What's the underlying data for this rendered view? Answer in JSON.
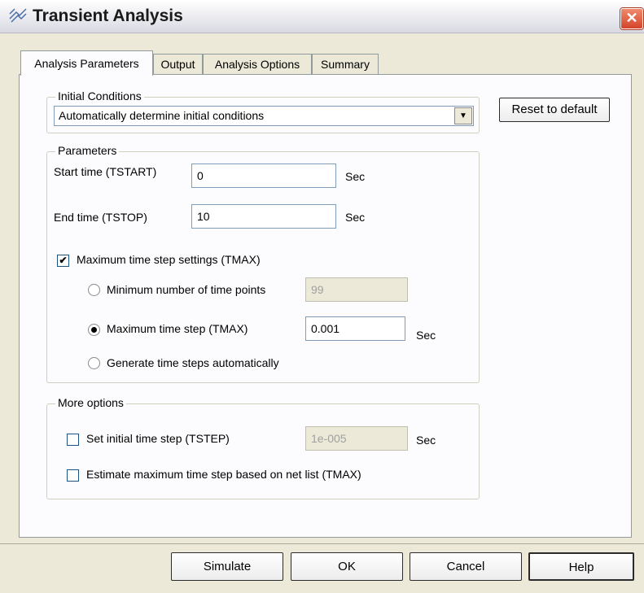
{
  "window": {
    "title": "Transient Analysis",
    "close_glyph": "✕",
    "app_icon": "grid-icon"
  },
  "tabs": [
    {
      "label": "Analysis Parameters",
      "active": true
    },
    {
      "label": "Output",
      "active": false
    },
    {
      "label": "Analysis Options",
      "active": false
    },
    {
      "label": "Summary",
      "active": false
    }
  ],
  "initial_conditions": {
    "legend": "Initial Conditions",
    "selected": "Automatically determine initial conditions"
  },
  "reset_button": "Reset to default",
  "parameters": {
    "legend": "Parameters",
    "start_label": "Start time (TSTART)",
    "start_value": "0",
    "start_unit": "Sec",
    "end_label": "End time (TSTOP)",
    "end_value": "10",
    "end_unit": "Sec",
    "max_step_settings_label": "Maximum time step settings (TMAX)",
    "max_step_settings_checked": true,
    "min_points_label": "Minimum number of time points",
    "min_points_value": "99",
    "max_step_label": "Maximum time step (TMAX)",
    "max_step_value": "0.001",
    "max_step_unit": "Sec",
    "auto_label": "Generate time steps automatically",
    "selected_radio": "max_step"
  },
  "more_options": {
    "legend": "More options",
    "tstep_label": "Set initial time step (TSTEP)",
    "tstep_value": "1e-005",
    "tstep_unit": "Sec",
    "tstep_checked": false,
    "estimate_label": "Estimate maximum time step based on net list (TMAX)",
    "estimate_checked": false
  },
  "buttons": {
    "simulate": "Simulate",
    "ok": "OK",
    "cancel": "Cancel",
    "help": "Help"
  },
  "check_glyph": "✔"
}
